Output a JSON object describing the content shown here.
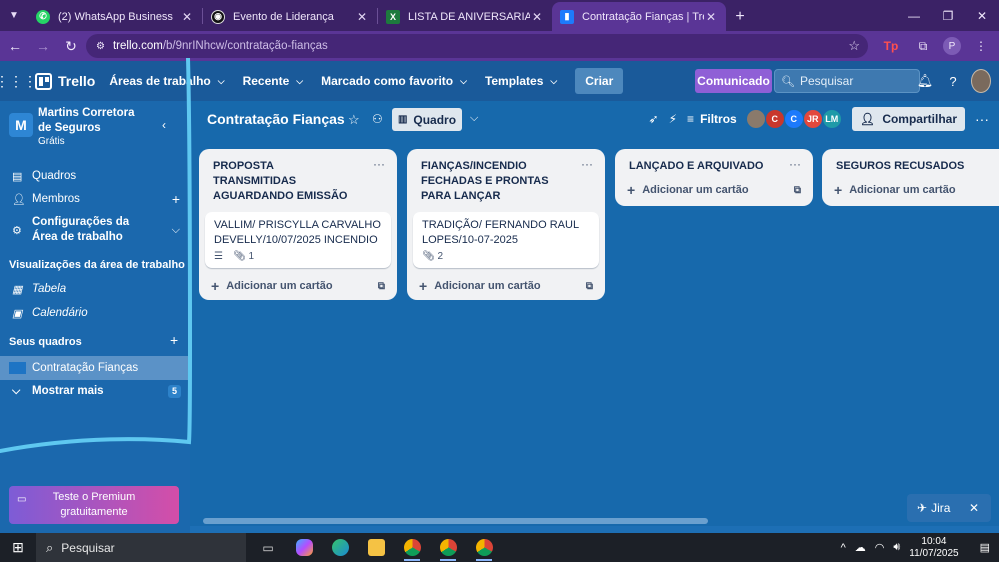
{
  "browser": {
    "tabs": [
      {
        "title": "(2) WhatsApp Business",
        "icon": "whatsapp-icon",
        "color": "#25d366"
      },
      {
        "title": "Evento de Liderança",
        "icon": "evento-icon",
        "color": "#222222"
      },
      {
        "title": "LISTA DE ANIVERSARIANTES AT",
        "icon": "excel-icon",
        "color": "#1d7a3e"
      },
      {
        "title": "Contratação Fianças | Trello",
        "icon": "trello-icon",
        "color": "#1d7afc",
        "active": true
      }
    ],
    "url_host": "trello.com",
    "url_path": "/b/9nrINhcw/contratação-fianças"
  },
  "header": {
    "logo": "Trello",
    "nav": [
      "Áreas de trabalho",
      "Recente",
      "Marcado como favorito",
      "Templates"
    ],
    "create": "Criar",
    "announcement": "Comunicado",
    "search_placeholder": "Pesquisar"
  },
  "sidebar": {
    "workspace_initial": "M",
    "workspace_name": "Martins Corretora de Seguros",
    "workspace_plan": "Grátis",
    "items": [
      "Quadros",
      "Membros",
      "Configurações da Área de trabalho"
    ],
    "views_title": "Visualizações da área de trabalho",
    "views": [
      "Tabela",
      "Calendário"
    ],
    "boards_title": "Seus quadros",
    "active_board": "Contratação Fianças",
    "show_more": "Mostrar mais",
    "show_more_count": "5",
    "premium": "Teste o Premium gratuitamente"
  },
  "board": {
    "title": "Contratação Fianças",
    "view": "Quadro",
    "filters": "Filtros",
    "share": "Compartilhar",
    "members": [
      {
        "initials": "",
        "color": "#8a7a6b"
      },
      {
        "initials": "C",
        "color": "#c9372c"
      },
      {
        "initials": "C",
        "color": "#1d7afc"
      },
      {
        "initials": "JR",
        "color": "#e2483d"
      },
      {
        "initials": "LM",
        "color": "#1f9aa8"
      }
    ],
    "lists": [
      {
        "title": "PROPOSTA TRANSMITIDAS AGUARDANDO EMISSÃO",
        "cards": [
          {
            "title": "VALLIM/ PRISCYLLA CARVALHO DEVELLY/10/07/2025 INCENDIO",
            "has_description": true,
            "attachments": "1"
          }
        ]
      },
      {
        "title": "FIANÇAS/INCENDIO FECHADAS E PRONTAS PARA LANÇAR",
        "cards": [
          {
            "title": "TRADIÇÃO/ FERNANDO RAUL LOPES/10-07-2025",
            "has_description": false,
            "attachments": "2"
          }
        ]
      },
      {
        "title": "LANÇADO E ARQUIVADO",
        "cards": []
      },
      {
        "title": "SEGUROS RECUSADOS",
        "cards": []
      }
    ],
    "add_card": "Adicionar um cartão"
  },
  "jira": "Jira",
  "taskbar": {
    "search": "Pesquisar",
    "time": "10:04",
    "date": "11/07/2025"
  }
}
